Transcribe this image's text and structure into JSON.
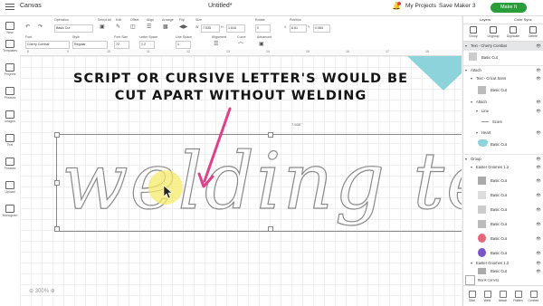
{
  "topbar": {
    "app_title": "Canvas",
    "document_title": "Untitled*",
    "my_projects": "My Projects",
    "save": "Save",
    "machine": "Maker 3",
    "make": "Make It"
  },
  "leftbar": {
    "items": [
      "New",
      "Templates",
      "Projects",
      "Phrases",
      "Images",
      "Text",
      "Phrases",
      "Upload",
      "Monogram"
    ]
  },
  "toolbar1": {
    "operation_label": "Operation",
    "operation_value": "Basic Cut",
    "select_all": "Select All",
    "edit": "Edit",
    "offset": "Offset",
    "align": "Align",
    "arrange": "Arrange",
    "flip": "Flip",
    "size_label": "Size",
    "w_label": "W",
    "w_value": "7.535",
    "h_label": "H",
    "h_value": "1.616",
    "rotate_label": "Rotate",
    "rotate_value": "0",
    "position_label": "Position",
    "x_label": "X",
    "x_value": "6.61",
    "y_label": "Y",
    "y_value": "0.084"
  },
  "toolbar2": {
    "font_label": "Font",
    "font_value": "Cherry Combat",
    "style_label": "Style",
    "style_value": "Regular",
    "font_size_label": "Font Size",
    "font_size_value": "72",
    "letter_space_label": "Letter Space",
    "letter_space_value": "1.2",
    "line_space_label": "Line Space",
    "line_space_value": "1",
    "alignment_label": "Alignment",
    "curve_label": "Curve",
    "advanced_label": "Advanced"
  },
  "ruler": {
    "marks": [
      "8",
      "9",
      "10",
      "11",
      "12",
      "13",
      "14",
      "15",
      "16",
      "17",
      "18"
    ]
  },
  "canvas": {
    "caption_line1": "SCRIPT OR CURSIVE LETTER'S WOULD BE",
    "caption_line2": "CUT APART WITHOUT WELDING",
    "word": "welding te",
    "width_label": "7.535\"",
    "zoom": "300%",
    "accent_color": "#e0408a",
    "cursor_highlight": "#f5e96a"
  },
  "rightpanel": {
    "tabs": [
      "Layers",
      "Color Sync"
    ],
    "actions": [
      "Group",
      "Ungroup",
      "Duplicate",
      "Delete"
    ],
    "layers": [
      {
        "label": "Text - Cherry Combat",
        "type": "header",
        "selected": true
      },
      {
        "label": "Basic Cut",
        "type": "item",
        "swatch": "#cccccc"
      },
      {
        "label": "Attach",
        "type": "group"
      },
      {
        "label": "Text - Cricut Sans",
        "type": "sub"
      },
      {
        "label": "Basic Cut",
        "type": "item2",
        "swatch": "#bbbbbb"
      },
      {
        "label": "Attach",
        "type": "sub"
      },
      {
        "label": "Line",
        "type": "sub2"
      },
      {
        "label": "Score",
        "type": "item3"
      },
      {
        "label": "Heart",
        "type": "sub2"
      },
      {
        "label": "Basic Cut",
        "type": "item2",
        "swatch": "#8cd3dc"
      },
      {
        "label": "Group",
        "type": "group"
      },
      {
        "label": "Easter Gnomes 1.2",
        "type": "sub"
      },
      {
        "label": "Basic Cut",
        "type": "item2",
        "swatch": "#aaaaaa"
      },
      {
        "label": "Basic Cut",
        "type": "item2",
        "swatch": "#dddddd"
      },
      {
        "label": "Basic Cut",
        "type": "item2",
        "swatch": "#cccccc"
      },
      {
        "label": "Basic Cut",
        "type": "item2",
        "swatch": "#bbbbbb"
      },
      {
        "label": "Basic Cut",
        "type": "item2",
        "swatch": "#e8667a"
      },
      {
        "label": "Basic Cut",
        "type": "item2",
        "swatch": "#7a55c9"
      },
      {
        "label": "Easter Gnomes 1.2",
        "type": "sub"
      },
      {
        "label": "Basic Cut",
        "type": "item2",
        "swatch": "#aaaaaa"
      }
    ],
    "blank_canvas": "Blank Canvas",
    "bottom_actions": [
      "Slice",
      "Weld",
      "Attach",
      "Flatten",
      "Contour"
    ]
  }
}
